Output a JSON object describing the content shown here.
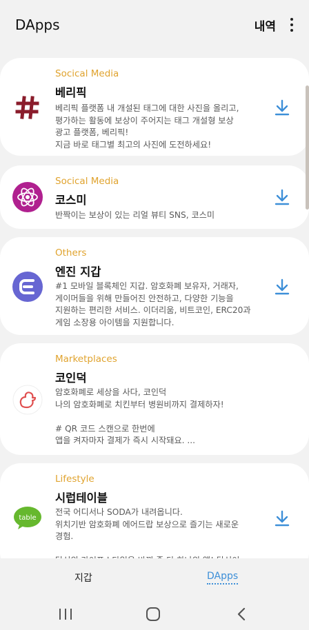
{
  "header": {
    "title": "DApps",
    "history_label": "내역",
    "more_icon": "more-vert-icon"
  },
  "dapps": [
    {
      "category": "Socical Media",
      "name": "베리픽",
      "description": "베리픽 플랫폼 내 개설된 태그에 대한 사진을 올리고,\n평가하는 활동에 보상이 주어지는 태그 개설형 보상\n광고 플랫폼, 베리픽!\n지금 바로 태그별 최고의 사진에 도전하세요!",
      "logo_icon": "hashtag-icon",
      "logo_color": "#8a1c2b"
    },
    {
      "category": "Socical Media",
      "name": "코스미",
      "description": "반짝이는 보상이 있는 리얼 뷰티 SNS, 코스미",
      "logo_icon": "atom-icon",
      "logo_color": "#b0208f"
    },
    {
      "category": "Others",
      "name": "엔진 지갑",
      "description": "#1 모바일 블록체인 지갑. 암호화폐 보유자, 거래자,\n게이머들을 위해 만들어진 안전하고, 다양한 기능을\n지원하는 편리한 서비스. 이더리움, 비트코인, ERC20과\n게임 소장용 아이템을 지원합니다.",
      "logo_icon": "enjin-icon",
      "logo_color": "#6766d2"
    },
    {
      "category": "Marketplaces",
      "name": "코인덕",
      "description": "암호화폐로 세상을 사다, 코인덕\n나의 암호화폐로 치킨부터 병원비까지 결제하자!\n\n# QR 코드 스캔으로 한번에\n앱을 켜자마자 결제가 즉시 시작돼요. ...",
      "logo_icon": "duck-icon",
      "logo_color": "#e05050"
    },
    {
      "category": "Lifestyle",
      "name": "시럽테이블",
      "description": "전국 어디서나 SODA가 내려옵니다.\n위치기반 암호화폐 에어드랍 보상으로 즐기는 새로운\n경험.\n\n당신의 라이프스타일을 바꿔 줄 단 하나의 앱! 당신이",
      "logo_icon": "table-icon",
      "logo_text": "table",
      "logo_color": "#66b82e"
    }
  ],
  "colors": {
    "category": "#e0a32e",
    "download": "#3d8fd8",
    "accent": "#3d8fd8"
  },
  "tabs": {
    "wallet": "지갑",
    "dapps": "DApps"
  },
  "system_nav": {
    "recent": "recent-apps-icon",
    "home": "home-icon",
    "back": "back-icon"
  }
}
